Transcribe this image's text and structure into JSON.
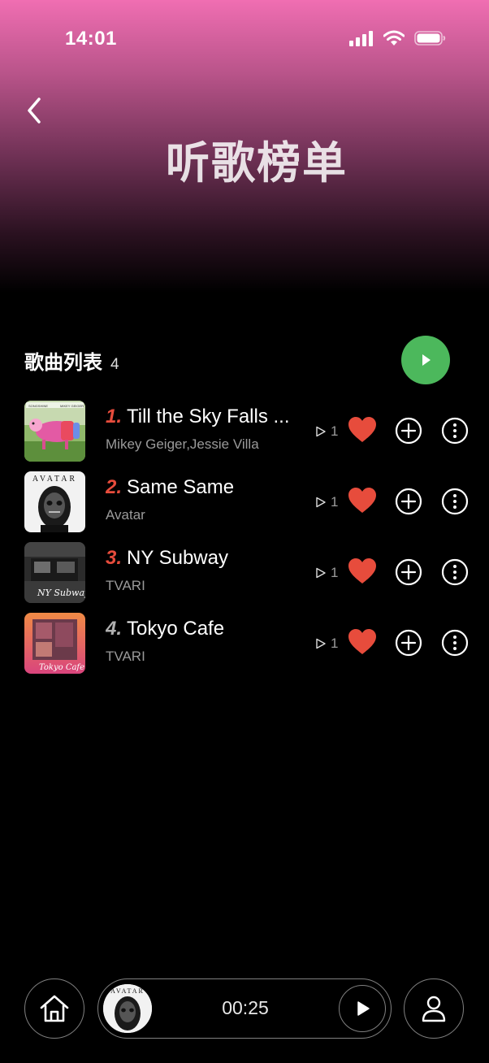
{
  "status_bar": {
    "time": "14:01"
  },
  "header": {
    "title": "听歌榜单"
  },
  "section": {
    "title": "歌曲列表",
    "count": "4"
  },
  "songs": [
    {
      "rank": "1.",
      "title": "Till the Sky Falls ...",
      "artist": "Mikey Geiger,Jessie Villa",
      "plays": "1",
      "rank_color": "#e74c3c",
      "liked": true
    },
    {
      "rank": "2.",
      "title": "Same Same",
      "artist": "Avatar",
      "plays": "1",
      "rank_color": "#e74c3c",
      "liked": true
    },
    {
      "rank": "3.",
      "title": "NY Subway",
      "artist": "TVARI",
      "plays": "1",
      "rank_color": "#e74c3c",
      "liked": true
    },
    {
      "rank": "4.",
      "title": "Tokyo Cafe",
      "artist": "TVARI",
      "plays": "1",
      "rank_color": "#b0b0b0",
      "liked": true
    }
  ],
  "covers": {
    "song1": {
      "label_left": "SONGSHINE",
      "label_right": "MIKEY GEIGER"
    },
    "song2": {
      "label": "AVATAR"
    },
    "song3": {
      "label": "NY Subway"
    },
    "song4": {
      "label": "Tokyo Cafe"
    }
  },
  "player": {
    "time": "00:25",
    "mini_cover_label": "AVATAR"
  },
  "colors": {
    "accent_red": "#e74c3c",
    "play_green": "#4cb85c",
    "header_pink": "#f06eb2"
  },
  "icons": [
    "back-chevron-icon",
    "signal-icon",
    "wifi-icon",
    "battery-icon",
    "play-icon",
    "heart-icon",
    "add-icon",
    "more-icon",
    "home-icon",
    "profile-icon"
  ]
}
